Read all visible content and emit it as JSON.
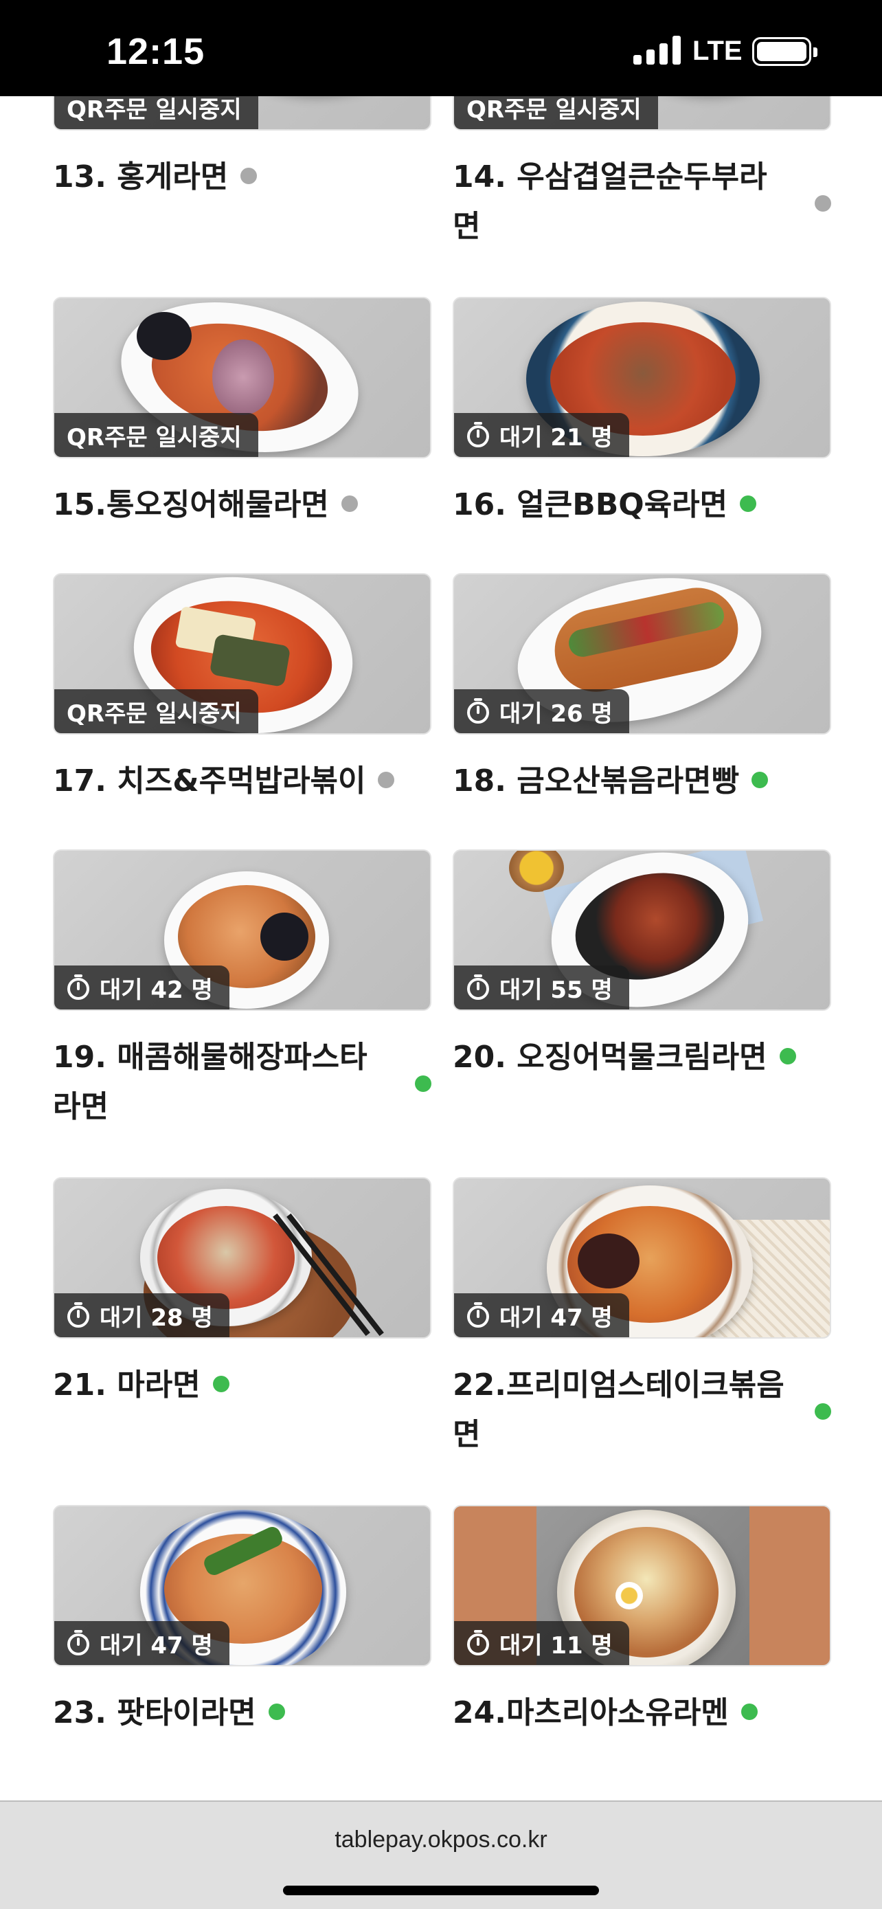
{
  "status_bar": {
    "time": "12:15",
    "network": "LTE"
  },
  "menu": {
    "items": [
      {
        "name": "13. 홍게라면",
        "status": "QR주문 일시중지",
        "available": false
      },
      {
        "name": "14. 우삼겹얼큰순두부라면",
        "status": "QR주문 일시중지",
        "available": false
      },
      {
        "name": "15.통오징어해물라면",
        "status": "QR주문 일시중지",
        "available": false
      },
      {
        "name": "16. 얼큰BBQ육라면",
        "status": "대기 21 명",
        "available": true
      },
      {
        "name": "17. 치즈&주먹밥라볶이",
        "status": "QR주문 일시중지",
        "available": false
      },
      {
        "name": "18. 금오산볶음라면빵",
        "status": "대기 26 명",
        "available": true
      },
      {
        "name": "19. 매콤해물해장파스타라면",
        "status": "대기 42 명",
        "available": true
      },
      {
        "name": "20. 오징어먹물크림라면",
        "status": "대기 55 명",
        "available": true
      },
      {
        "name": "21. 마라면",
        "status": "대기 28 명",
        "available": true
      },
      {
        "name": "22.프리미엄스테이크볶음면",
        "status": "대기 47 명",
        "available": true
      },
      {
        "name": "23. 팟타이라면",
        "status": "대기 47 명",
        "available": true
      },
      {
        "name": "24.마츠리아소유라멘",
        "status": "대기 11 명",
        "available": true
      }
    ]
  },
  "browser": {
    "url": "tablepay.okpos.co.kr"
  },
  "colors": {
    "available_dot": "#3dbb4f",
    "paused_dot": "#a9a9a9",
    "badge_bg": "#1e1e1e"
  },
  "icons": {
    "wait": "timer-icon",
    "availability": "status-dot"
  }
}
